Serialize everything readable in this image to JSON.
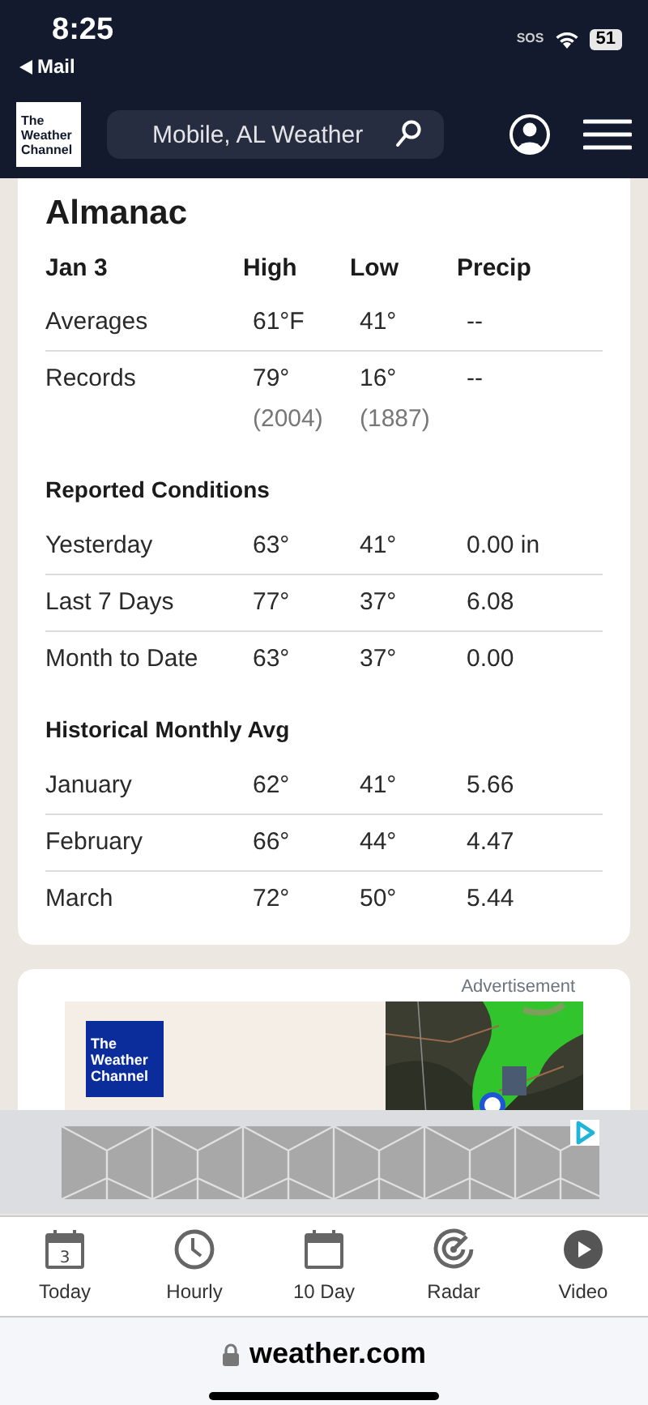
{
  "status_bar": {
    "time": "8:25",
    "back_label": "Mail",
    "sos": "SOS",
    "battery": "51"
  },
  "header": {
    "logo_lines": [
      "The",
      "Weather",
      "Channel"
    ],
    "search_value": "Mobile, AL Weather"
  },
  "almanac": {
    "title": "Almanac",
    "columns": [
      "Jan 3",
      "High",
      "Low",
      "Precip"
    ],
    "rows": [
      {
        "label": "Averages",
        "high": "61°F",
        "low": "41°",
        "precip": "--"
      },
      {
        "label": "Records",
        "high": "79°",
        "low": "16°",
        "precip": "--",
        "high_note": "(2004)",
        "low_note": "(1887)"
      }
    ],
    "sections": [
      {
        "heading": "Reported Conditions",
        "rows": [
          {
            "label": "Yesterday",
            "high": "63°",
            "low": "41°",
            "precip": "0.00 in"
          },
          {
            "label": "Last 7 Days",
            "high": "77°",
            "low": "37°",
            "precip": "6.08"
          },
          {
            "label": "Month to Date",
            "high": "63°",
            "low": "37°",
            "precip": "0.00"
          }
        ]
      },
      {
        "heading": "Historical Monthly Avg",
        "rows": [
          {
            "label": "January",
            "high": "62°",
            "low": "41°",
            "precip": "5.66"
          },
          {
            "label": "February",
            "high": "66°",
            "low": "44°",
            "precip": "4.47"
          },
          {
            "label": "March",
            "high": "72°",
            "low": "50°",
            "precip": "5.44"
          }
        ]
      }
    ]
  },
  "ad": {
    "label": "Advertisement",
    "logo_lines": [
      "The",
      "Weather",
      "Channel"
    ],
    "map": {
      "kind": "picture"
    }
  },
  "nav": [
    {
      "label": "Today",
      "icon_text": "3"
    },
    {
      "label": "Hourly"
    },
    {
      "label": "10 Day"
    },
    {
      "label": "Radar"
    },
    {
      "label": "Video"
    }
  ],
  "url_bar": {
    "url": "weather.com"
  }
}
